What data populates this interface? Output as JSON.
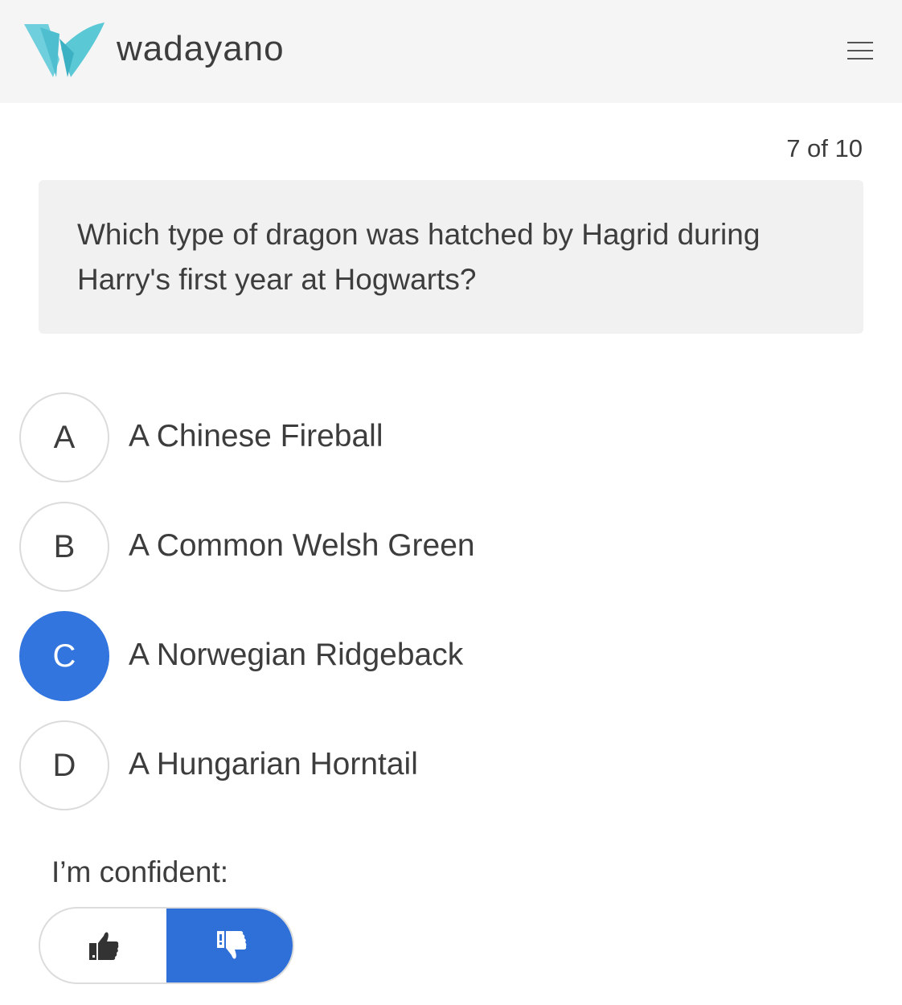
{
  "header": {
    "brand": "wadayano",
    "logo_icon": "wadayano-logo-icon",
    "menu_icon": "hamburger-menu-icon"
  },
  "quiz": {
    "progress": "7 of 10",
    "question": "Which type of dragon was hatched by Hagrid during Harry's first year at Hogwarts?",
    "options": [
      {
        "letter": "A",
        "text": "A Chinese Fireball",
        "selected": false
      },
      {
        "letter": "B",
        "text": "A Common Welsh Green",
        "selected": false
      },
      {
        "letter": "C",
        "text": "A Norwegian Ridgeback",
        "selected": true
      },
      {
        "letter": "D",
        "text": "A Hungarian Horntail",
        "selected": false
      }
    ]
  },
  "confidence": {
    "label": "I’m confident:",
    "yes_icon": "thumbs-up-icon",
    "no_icon": "thumbs-down-icon",
    "selected": "no"
  },
  "colors": {
    "accent": "#3375de",
    "logo": "#5bc8d6",
    "header_bg": "#f5f5f5"
  }
}
